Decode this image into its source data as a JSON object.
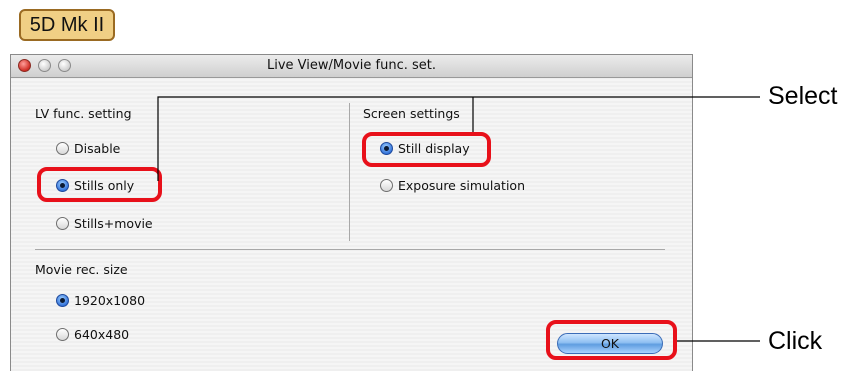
{
  "badge": {
    "label": "5D Mk II"
  },
  "window": {
    "title": "Live View/Movie func. set."
  },
  "lv_group": {
    "title": "LV func. setting",
    "options": [
      {
        "label": "Disable",
        "selected": false
      },
      {
        "label": "Stills only",
        "selected": true
      },
      {
        "label": "Stills+movie",
        "selected": false
      }
    ]
  },
  "screen_group": {
    "title": "Screen settings",
    "options": [
      {
        "label": "Still display",
        "selected": true
      },
      {
        "label": "Exposure simulation",
        "selected": false
      }
    ]
  },
  "movie_group": {
    "title": "Movie rec. size",
    "options": [
      {
        "label": "1920x1080",
        "selected": true
      },
      {
        "label": "640x480",
        "selected": false
      }
    ]
  },
  "ok_button": {
    "label": "OK"
  },
  "callouts": {
    "select": "Select",
    "click": "Click"
  },
  "colors": {
    "highlight": "#e8101a",
    "badge_fill": "#f0cf85",
    "radio_on": "#2f6fd8"
  }
}
